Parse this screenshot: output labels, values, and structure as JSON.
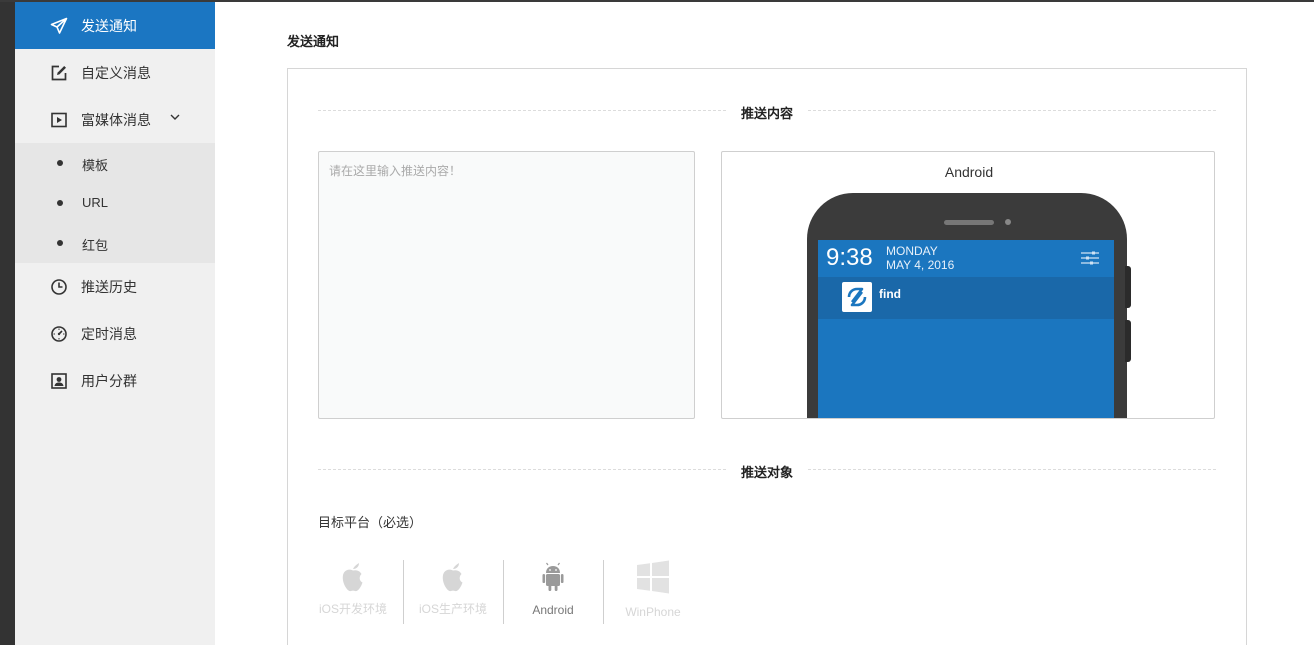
{
  "sidebar": {
    "items": [
      {
        "label": "发送通知",
        "icon": "paper-plane-icon"
      },
      {
        "label": "自定义消息",
        "icon": "edit-icon"
      },
      {
        "label": "富媒体消息",
        "icon": "play-icon"
      },
      {
        "label": "推送历史",
        "icon": "clock-icon"
      },
      {
        "label": "定时消息",
        "icon": "timer-icon"
      },
      {
        "label": "用户分群",
        "icon": "user-group-icon"
      }
    ],
    "submenu": [
      {
        "label": "模板"
      },
      {
        "label": "URL"
      },
      {
        "label": "红包"
      }
    ]
  },
  "main": {
    "page_title": "发送通知",
    "sections": {
      "content_title": "推送内容",
      "target_title": "推送对象"
    },
    "content_input": {
      "placeholder": "请在这里输入推送内容！",
      "value": ""
    },
    "preview": {
      "title": "Android",
      "time": "9:38",
      "day": "MONDAY",
      "date": "MAY 4, 2016",
      "app_name": "find"
    },
    "target_platform": {
      "label": "目标平台（必选）",
      "options": [
        {
          "label": "iOS开发环境",
          "icon": "apple-icon"
        },
        {
          "label": "iOS生产环境",
          "icon": "apple-icon"
        },
        {
          "label": "Android",
          "icon": "android-icon"
        },
        {
          "label": "WinPhone",
          "icon": "windows-icon"
        }
      ]
    }
  },
  "colors": {
    "accent": "#1b76c2",
    "sidebar_bg": "#f0f0f0",
    "submenu_bg": "#e6e6e6",
    "disabled": "#d6d6d6",
    "android_gray": "#9a9a9a"
  }
}
